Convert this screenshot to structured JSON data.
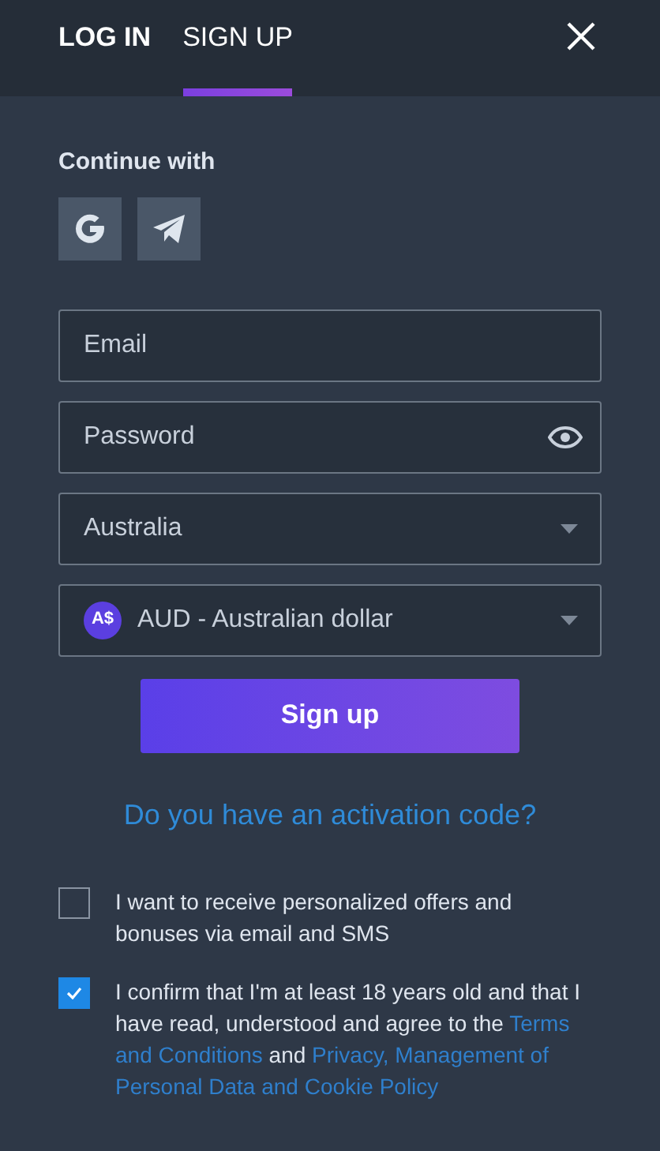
{
  "tabs": [
    {
      "label": "LOG IN",
      "selected": false
    },
    {
      "label": "SIGN UP",
      "selected": true
    }
  ],
  "continue_with": {
    "label": "Continue with",
    "providers": [
      {
        "kind": "google"
      },
      {
        "kind": "telegram"
      }
    ]
  },
  "fields": [
    {
      "kind": "text",
      "placeholder": "Email"
    },
    {
      "kind": "password",
      "placeholder": "Password"
    },
    {
      "kind": "select",
      "value": "Australia"
    },
    {
      "kind": "currency",
      "badge": "A$",
      "value": "AUD - Australian dollar"
    }
  ],
  "submit": "Sign up",
  "activation_link": "Do you have an activation code?",
  "consents": [
    {
      "checked": false,
      "parts": [
        {
          "kind": "text",
          "text": "I want to receive personalized offers and bonuses via email and SMS"
        }
      ]
    },
    {
      "checked": true,
      "parts": [
        {
          "kind": "text",
          "text": "I confirm that I'm at least 18 years old and that I have read, understood and agree to the "
        },
        {
          "kind": "link",
          "text": "Terms and Conditions"
        },
        {
          "kind": "text",
          "text": " and "
        },
        {
          "kind": "link",
          "text": "Privacy, Management of Personal Data and Cookie Policy"
        }
      ]
    }
  ]
}
